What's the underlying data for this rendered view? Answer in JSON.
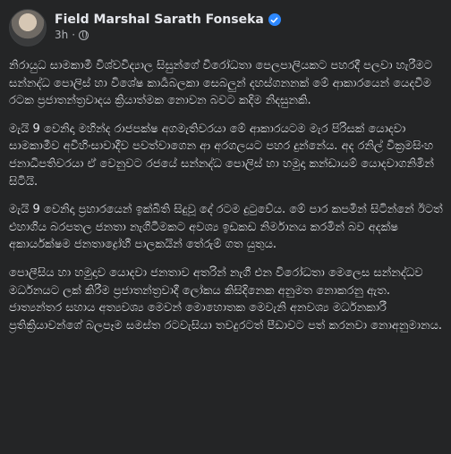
{
  "post": {
    "author": "Field Marshal Sarath Fonseka",
    "timestamp": "3h",
    "separator": "·",
    "paragraphs": [
      "නිරායුධ සාමකාමී විශ්වවිද්‍යාල සිසුන්ගේ විරෝධතා පෙලපාලියකට පහරදී පලවා හැරීමට සන්නද්ධ පොලිස් හා විශේෂ කාර්‍යබලකා සෙබලුන් දහස්ගනනක් මේ ආකාරයෙන් යෙදවීම රටක ප්‍රජාතන්ත්‍රවාදය ක්‍රියාත්මක නොවන බවට කදිම නිදසුනකි.",
      "මැයි 9 වෙනිදා මහින්ද රාජපක්ෂ අගමැතිවරයා මේ ආකාරයටම මැර පිරිසක් යොදවා සාමකාමීව අවිහිංසාවාදීව පවත්වාගෙන ආ අරගලයට පහර දුන්නේය. අද රනිල් වික්‍රමසිංහ ජනාධිපතිවරයා ඒ වෙනුවට රජයේ සන්නද්ධ පොලිස් හා හමුදා කන්ඩායම් යොදවාගනිමින් සිටියි.",
      "මැයි 9 වෙනිදා ප්‍රහාරයෙන් ඉක්බිති සිදුවූ දේ රටම දුටුවේය. මේ පාර කපමින් සිටින්නේ ඊටත් එහාගිය බරපතල ජනතා නැගිටීමකට අවශ්‍ය ඉඩකඩ නිර්මානය කරමින් බව අදක්ෂ අකාර්යක්ෂම ජනතාද්‍රෝහී පාලකයින් තේරුම් ගත යුතුය.",
      "පොලීසිය හා හමුදාව යොදවා ජනතාව අතරින් නැගී එන විරෝධතා මෙලෙස සන්නද්ධව මර්ධනයට ලක් කිරීම ප්‍රජාතන්ත්‍රවාදී ලෝකය කිසිදිනෙක අනුමත නොකරනු ඇත. ජාත්‍යන්තර සහාය අත්‍යවශ්‍ය මෙවන් මොහොතක මෙවැනි අනවශ්‍ය මර්ධනකාරී ප්‍රතික්‍රියාවන්ගේ බලපෑම සමස්ත රටවැසියා තවදුරටත් පීඩාවට පත් කරනවා නොඅනුමානය."
    ]
  },
  "colors": {
    "background": "#242526",
    "text_primary": "#e4e6eb",
    "text_secondary": "#b0b3b8",
    "verified_badge": "#2d88ff"
  },
  "icons": [
    "verified-badge-icon",
    "globe-icon"
  ]
}
